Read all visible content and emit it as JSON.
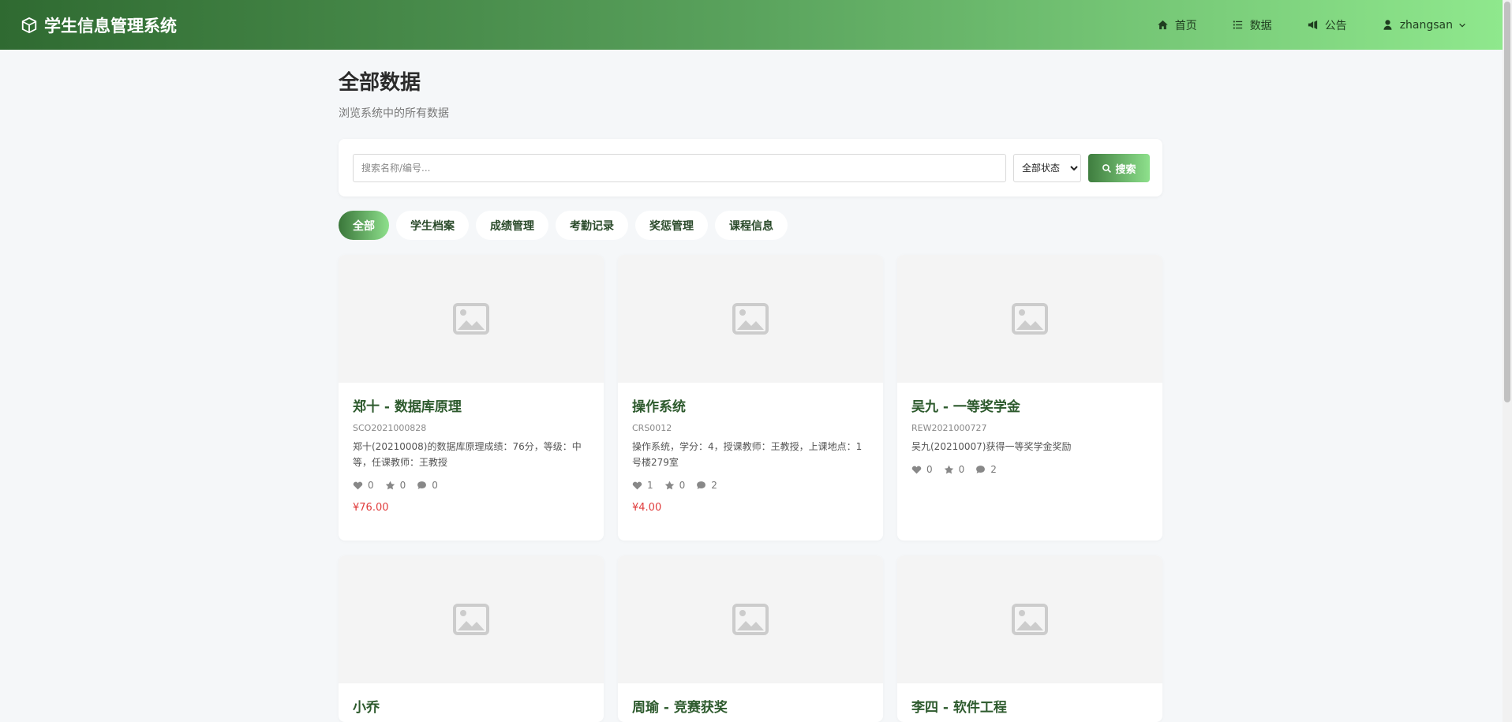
{
  "nav": {
    "brand": "学生信息管理系统",
    "items": [
      {
        "label": "首页",
        "icon": "home-icon"
      },
      {
        "label": "数据",
        "icon": "list-icon"
      },
      {
        "label": "公告",
        "icon": "megaphone-icon"
      }
    ],
    "user": "zhangsan"
  },
  "page": {
    "title": "全部数据",
    "subtitle": "浏览系统中的所有数据"
  },
  "search": {
    "placeholder": "搜索名称/编号...",
    "value": "",
    "status_selected": "全部状态",
    "button_label": "搜索"
  },
  "tabs": [
    "全部",
    "学生档案",
    "成绩管理",
    "考勤记录",
    "奖惩管理",
    "课程信息"
  ],
  "active_tab": "全部",
  "cards": [
    {
      "title": "郑十 - 数据库原理",
      "code": "SCO2021000828",
      "desc": "郑十(20210008)的数据库原理成绩：76分，等级：中等，任课教师：王教授",
      "likes": "0",
      "favorites": "0",
      "comments": "0",
      "price": "¥76.00"
    },
    {
      "title": "操作系统",
      "code": "CRS0012",
      "desc": "操作系统，学分：4，授课教师：王教授，上课地点：1号楼279室",
      "likes": "1",
      "favorites": "0",
      "comments": "2",
      "price": "¥4.00"
    },
    {
      "title": "吴九 - 一等奖学金",
      "code": "REW2021000727",
      "desc": "吴九(20210007)获得一等奖学金奖励",
      "likes": "0",
      "favorites": "0",
      "comments": "2",
      "price": ""
    },
    {
      "title": "小乔",
      "code": "",
      "desc": "",
      "likes": "",
      "favorites": "",
      "comments": "",
      "price": ""
    },
    {
      "title": "周瑜 - 竞赛获奖",
      "code": "",
      "desc": "",
      "likes": "",
      "favorites": "",
      "comments": "",
      "price": ""
    },
    {
      "title": "李四 - 软件工程",
      "code": "",
      "desc": "",
      "likes": "",
      "favorites": "",
      "comments": "",
      "price": ""
    }
  ],
  "colors": {
    "accent": "#2d5a2d",
    "price": "#e03c3c",
    "nav_gradient_start": "#2f6a31",
    "nav_gradient_end": "#8fe88d"
  }
}
